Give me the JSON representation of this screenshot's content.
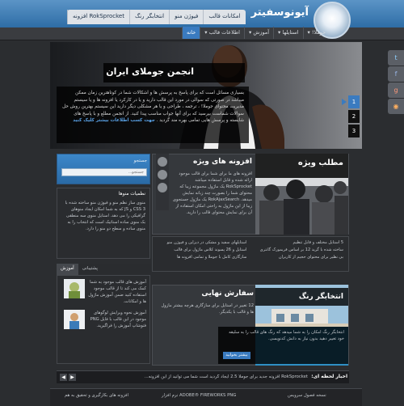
{
  "header": {
    "logo_text": "آیونوسفیتر",
    "top_nav": [
      "RokSprocket افزونه",
      "انتخابگر رنگ",
      "فیوژن منو",
      "امکانات قالب"
    ],
    "main_nav": [
      "خانه",
      "اطلاعات قالب ▾",
      "آموزش ▾",
      "استایلها ▾",
      "جوملا! ▾"
    ]
  },
  "slider": {
    "title": "انجمن جوملای ایران",
    "body": "بسیاری مسائل است که برای پاسخ به پرسش ها و اشکالات شما در کوتاهترین زمان ممکن میباشد در صورتی که سوالی در مورد این قالب دارید و یا در کارکرد یا افزونه ها و یا سیستم مدیریت محتوای جوملا! ، ترجمه ، طراحی و یا هر مشکلی دیگر دارید این سیستم بهترین روش حل سوالات شماست بپرسید که برای آنها جواب مناسب پیدا کنید. از انجمن مطلع و با پاسخ های شایسته و پرسش هایی تمامی بهره مند گردید .",
    "link": "جهت کسب اطلاعات بیشتر کلیک کنید",
    "numbers": [
      "1",
      "2",
      "3"
    ]
  },
  "login": {
    "label": "جستجو",
    "placeholder": "جستجو..."
  },
  "feature": {
    "image_title": "مطلب ویژه",
    "title": "افزونه های ویژه",
    "text": "افزونه های ما برای شما برای قالب موجود ارائه شده و قابل استفاده میباشد RokSprocket یک ماژول مجموعه زیبا که محتوای شما را بصورت چند زبانه نمایش میدهد. RokAjaxSearch یک ماژول جستجوی زیبا از این ماژول به راحتی امکان استفاده از آن برای نمایش محتوای قالب را دارید.",
    "list": [
      [
        "استایلهای سفید و مشکی در دیزاین و فیوژن منو",
        "5 استایل مختلف و قابل تنظیم"
      ],
      [
        "استایل و 26 پسوند کلاس ماژول برای قالب",
        "ساخته شده با گرید 12 بر اساس فریمورک گانتری"
      ],
      [
        "سازگاری کامل با جوملا و تمامی افزونه ها",
        "بی نظیر برای محتوای حجیم از کاربران"
      ]
    ]
  },
  "module1": {
    "title": "نظمیات منوها",
    "text": "منوی ساز نظم منو و فیوژن منو ساخته شده با 3 CSS و JS که به شما امکان ایجاد منوهای گرافیکی را می دهد. استایل منوی سه منطقی بک منوی ساده استاتیک است که انتخاب را به منوی ساده و سطح دو منو را دارد."
  },
  "tabs": [
    "آموزش",
    "پشتیبانی"
  ],
  "posts": [
    {
      "text": "آموزش های قالب موجود به شما کمک می کند تا از قالب موجود استفاده کنید ضمن آموزش ماژول ها و امکانات."
    },
    {
      "text": "آموزش نحوه ویرایش لوگوهای موجود در این قالب با فایل PNG فتوشاپ آموزش را فراگیرید."
    }
  ],
  "bottom": {
    "title": "سفارش نهایی",
    "text": "12 تغییر در استایل برای سازگاری هرچه بیشتر مازول ها و قالب با یکدیگر.",
    "image_title": "انتخابگر رنگ",
    "image_text": "انتخابگر رنگ امکان را به شما میدهد که رنگ های قالب را به سلیقه خود تغییر دهید بدون نیاز به دانش کدنویسی.",
    "button": "بیشتر بخوانید"
  },
  "ticker": {
    "label": "اخبار لحظه ای:",
    "text": "RokSprocket افزونه جدید برای جوملا 2.5 ایجاد گردید است شما می توانید از این افزونه..."
  },
  "footer": {
    "left": "افزونه های بکارگیری و تحقیق به هم",
    "middle": "ADOBE® FIREWORKS PNG نرم افزار",
    "right": "نسخه فصول سرویس"
  }
}
